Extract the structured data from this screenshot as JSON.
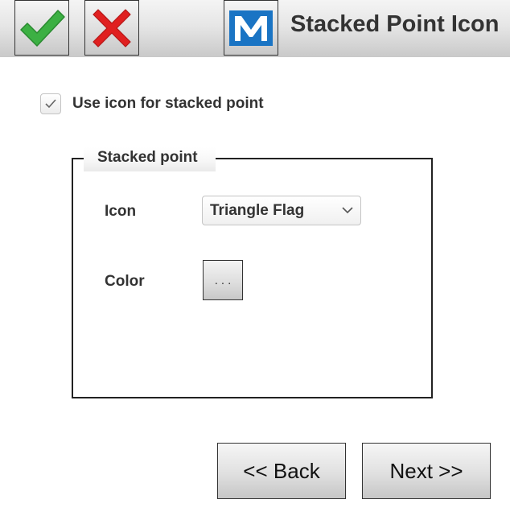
{
  "header": {
    "title": "Stacked Point Icon",
    "ok_icon": "check-icon",
    "cancel_icon": "cross-icon",
    "logo_icon": "m-logo-icon",
    "logo_color": "#1a74c4",
    "ok_color": "#3cb043",
    "cancel_color": "#e02020"
  },
  "option": {
    "label": "Use icon for stacked point",
    "checked": true
  },
  "group": {
    "title": "Stacked point",
    "icon_label": "Icon",
    "icon_value": "Triangle Flag",
    "color_label": "Color",
    "color_button_label": "..."
  },
  "nav": {
    "back_label": "<< Back",
    "next_label": "Next >>"
  }
}
